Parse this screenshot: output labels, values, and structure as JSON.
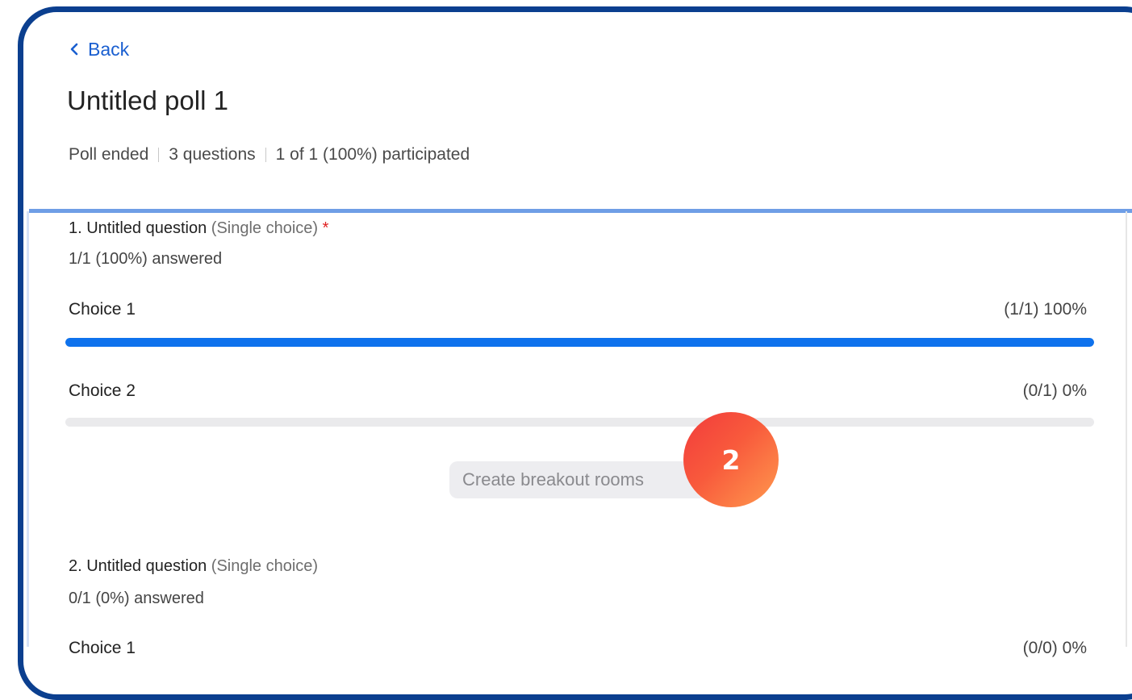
{
  "header": {
    "back_label": "Back",
    "title": "Untitled poll 1",
    "meta": [
      "Poll ended",
      "3 questions",
      "1 of 1 (100%) participated"
    ]
  },
  "questions": [
    {
      "title": "1. Untitled question",
      "type": "(Single choice)",
      "required_mark": "*",
      "answered": "1/1 (100%) answered",
      "choices": [
        {
          "label": "Choice 1",
          "result": "(1/1) 100%",
          "percent": 100
        },
        {
          "label": "Choice 2",
          "result": "(0/1) 0%",
          "percent": 0
        }
      ],
      "breakout_label": "Create breakout rooms"
    },
    {
      "title": "2. Untitled question",
      "type": "(Single choice)",
      "answered": "0/1 (0%) answered",
      "choices": [
        {
          "label": "Choice 1",
          "result": "(0/0) 0%"
        }
      ]
    }
  ],
  "step_badge": "2",
  "colors": {
    "frame": "#0b3f8f",
    "accent": "#0e72ed",
    "link": "#1a5fd0",
    "badge_start": "#f23b3b",
    "badge_end": "#ff9a4e"
  }
}
